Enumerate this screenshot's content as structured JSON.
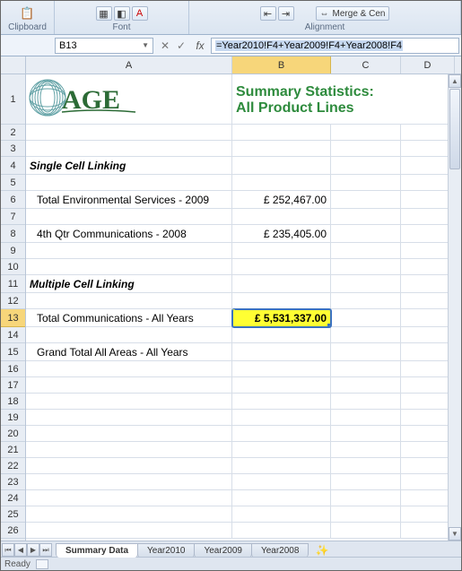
{
  "ribbon": {
    "clipboard_label": "Clipboard",
    "font_label": "Font",
    "alignment_label": "Alignment",
    "merge_label": "Merge & Cen"
  },
  "name_box": "B13",
  "fx": "fx",
  "formula": "=Year2010!F4+Year2009!F4+Year2008!F4",
  "columns": [
    "A",
    "B",
    "C",
    "D"
  ],
  "rows": {
    "r1_height": 56,
    "title1": "Summary Statistics:",
    "title2": "All Product Lines",
    "r4_label": "Single Cell Linking",
    "r6_label": "Total Environmental Services - 2009",
    "r6_val": "£    252,467.00",
    "r8_label": "4th Qtr Communications - 2008",
    "r8_val": "£    235,405.00",
    "r11_label": "Multiple Cell Linking",
    "r13_label": "Total Communications - All Years",
    "r13_val": "£ 5,531,337.00",
    "r15_label": "Grand Total All Areas - All Years"
  },
  "row_numbers": [
    1,
    2,
    3,
    4,
    5,
    6,
    7,
    8,
    9,
    10,
    11,
    12,
    13,
    14,
    15,
    16,
    17,
    18,
    19,
    20,
    21,
    22,
    23,
    24,
    25,
    26
  ],
  "tabs": {
    "active": "Summary Data",
    "others": [
      "Year2010",
      "Year2009",
      "Year2008"
    ]
  },
  "status": "Ready",
  "chart_data": {
    "type": "table",
    "title": "Summary Statistics: All Product Lines",
    "rows": [
      {
        "label": "Total Environmental Services - 2009",
        "value_gbp": 252467.0
      },
      {
        "label": "4th Qtr Communications - 2008",
        "value_gbp": 235405.0
      },
      {
        "label": "Total Communications - All Years",
        "value_gbp": 5531337.0
      },
      {
        "label": "Grand Total All Areas - All Years",
        "value_gbp": null
      }
    ]
  }
}
